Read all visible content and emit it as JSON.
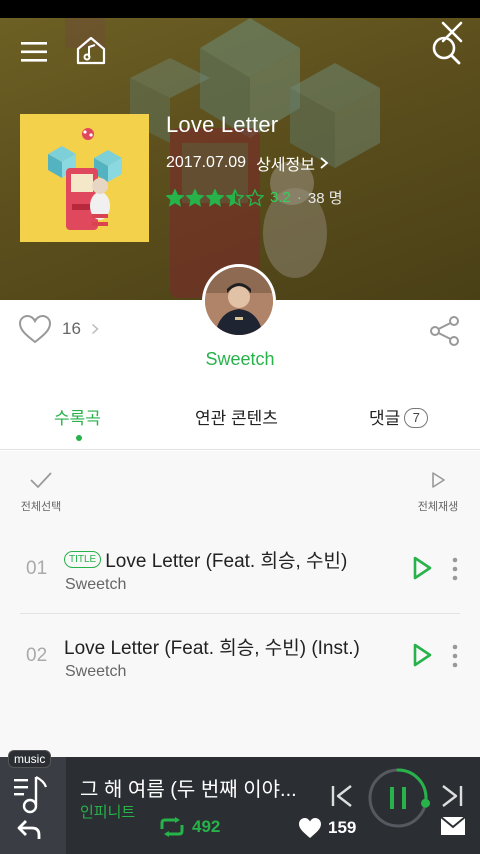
{
  "album": {
    "title": "Love Letter",
    "release_date": "2017.07.09",
    "detail_label": "상세정보",
    "rating": "3.2",
    "rating_count": "38 명",
    "stars_filled": 3.5
  },
  "likes": {
    "count": "16"
  },
  "artist": {
    "name": "Sweetch"
  },
  "tabs": {
    "tracks": "수록곡",
    "related": "연관 콘텐츠",
    "comments": "댓글",
    "comment_count": "7"
  },
  "actions": {
    "select_all": "전체선택",
    "play_all": "전체재생"
  },
  "tracks": [
    {
      "number": "01",
      "badge": "TITLE",
      "title": "Love Letter (Feat. 희승, 수빈)",
      "artist": "Sweetch"
    },
    {
      "number": "02",
      "badge": "",
      "title": "Love Letter (Feat. 희승, 수빈) (Inst.)",
      "artist": "Sweetch"
    }
  ],
  "player": {
    "tag": "music",
    "now_playing_title": "그 해 여름 (두 번째 이야...",
    "now_playing_artist": "인피니트",
    "repost_count": "492",
    "like_count": "159",
    "progress": 0.28
  },
  "colors": {
    "accent": "#27b24a",
    "hero_bg": "#5c4f1d",
    "player_bg": "#2b2f34"
  },
  "icons": [
    "menu-icon",
    "home-music-icon",
    "close-icon",
    "search-icon",
    "star-icon",
    "heart-icon",
    "share-icon",
    "check-icon",
    "play-icon",
    "more-icon",
    "playlist-icon",
    "back-icon",
    "prev-icon",
    "pause-icon",
    "next-icon",
    "repost-icon",
    "mail-icon"
  ]
}
